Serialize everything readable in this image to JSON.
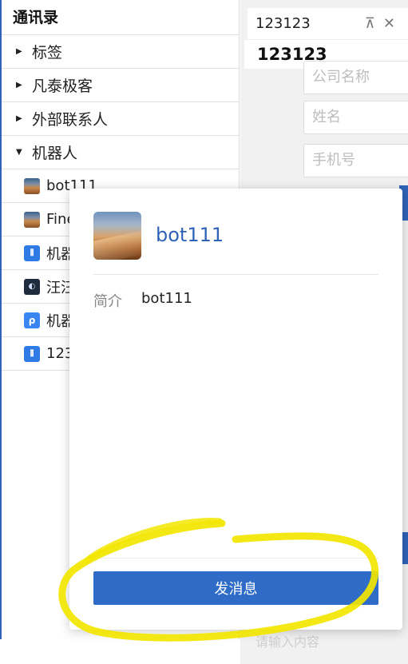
{
  "left_panel": {
    "title": "通讯录",
    "groups": [
      {
        "label": "标签",
        "expanded": false
      },
      {
        "label": "凡泰极客",
        "expanded": false
      },
      {
        "label": "外部联系人",
        "expanded": false
      },
      {
        "label": "机器人",
        "expanded": true
      }
    ],
    "robot_items": [
      {
        "label": "bot111",
        "icon": "desert-avatar-icon"
      },
      {
        "label": "Fine",
        "icon": "desert-avatar-icon"
      },
      {
        "label": "机器",
        "icon": "robot-icon"
      },
      {
        "label": "汪汪",
        "icon": "finogeeks-logo-icon"
      },
      {
        "label": "机器",
        "icon": "p-app-icon"
      },
      {
        "label": "123",
        "icon": "robot-icon"
      }
    ]
  },
  "right_panel": {
    "tab_label": "123123",
    "header": "123123",
    "fields": {
      "company_placeholder": "公司名称",
      "name_placeholder": "姓名",
      "phone_placeholder": "手机号"
    },
    "bottom_hint": "请输入内容"
  },
  "popup": {
    "bot_name": "bot111",
    "intro_label": "简介",
    "intro_value": "bot111",
    "send_button": "发消息"
  },
  "colors": {
    "accent": "#2f6cc8",
    "link": "#2f63b8",
    "highlight": "#f2e600"
  }
}
